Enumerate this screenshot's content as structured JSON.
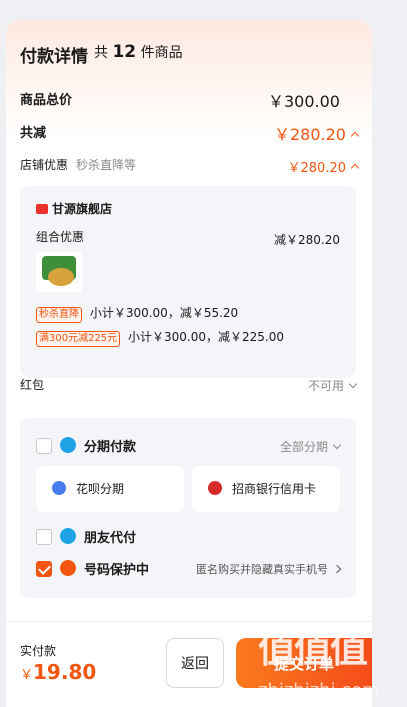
{
  "header": {
    "title": "付款详情",
    "count_prefix": "共",
    "count": "12",
    "count_suffix": "件商品"
  },
  "summary": {
    "total_label": "商品总价",
    "total_value": "￥300.00",
    "discount_label": "共减",
    "discount_value": "￥280.20",
    "store_discount_label": "店铺优惠",
    "store_discount_desc": "秒杀直降等",
    "store_discount_value": "￥280.20"
  },
  "store": {
    "name": "甘源旗舰店",
    "combo_label": "组合优惠",
    "combo_value": "减￥280.20",
    "promos": [
      {
        "tag": "秒杀直降",
        "text": "小计￥300.00，减￥55.20"
      },
      {
        "tag": "满300元减225元",
        "text": "小计￥300.00，减￥225.00"
      }
    ]
  },
  "red_packet": {
    "label": "红包",
    "value": "不可用"
  },
  "payment": {
    "installment_label": "分期付款",
    "installment_action": "全部分期",
    "options": [
      {
        "label": "花呗分期"
      },
      {
        "label": "招商银行信用卡"
      }
    ],
    "friend_pay_label": "朋友代付",
    "privacy_label": "号码保护中",
    "privacy_desc": "匿名购买并隐藏真实手机号"
  },
  "footer": {
    "actual_label": "实付款",
    "currency": "￥",
    "actual_value": "19.80",
    "back_label": "返回",
    "pay_label": "提交订单"
  },
  "watermark": {
    "logo": "值值值",
    "site": "zhizhizhi.com"
  },
  "colors": {
    "accent": "#f2550f",
    "background": "#eef0f4"
  }
}
